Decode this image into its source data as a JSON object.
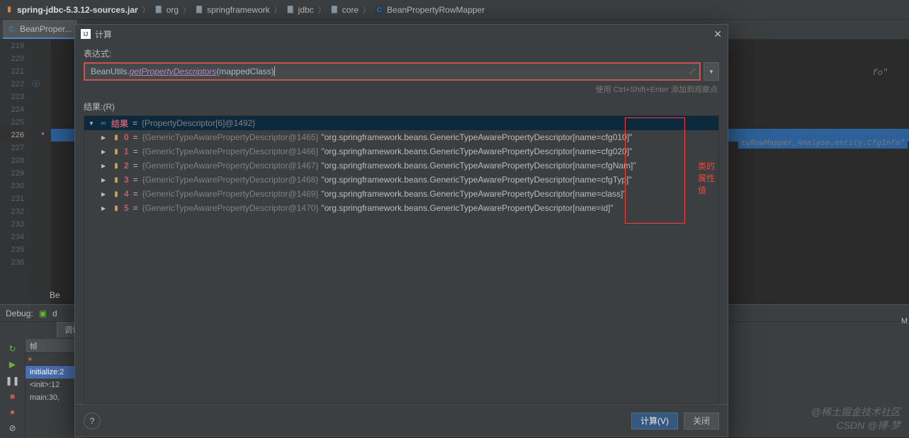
{
  "breadcrumb": [
    {
      "icon": "jar",
      "label": "spring-jdbc-5.3.12-sources.jar",
      "bold": true
    },
    {
      "icon": "folder",
      "label": "org"
    },
    {
      "icon": "folder",
      "label": "springframework"
    },
    {
      "icon": "folder",
      "label": "jdbc"
    },
    {
      "icon": "folder",
      "label": "core"
    },
    {
      "icon": "class",
      "label": "BeanPropertyRowMapper"
    }
  ],
  "tab": {
    "label": "BeanProper..."
  },
  "gutter": {
    "start": 219,
    "end": 236,
    "highlight": 226
  },
  "editor": {
    "right_hint_220": "fo\"",
    "right_hint_226": "tyRowMapper_Analyse.entity.CfgInfo\"",
    "trailing_label": "Be"
  },
  "dialog": {
    "title": "计算",
    "expr_label": "表达式:",
    "expr": {
      "cls": "BeanUtils.",
      "method": "getPropertyDescriptors",
      "open": "(",
      "param": "mappedClass",
      "close": ")"
    },
    "hint": "使用 Ctrl+Shift+Enter 添加到观察点",
    "result_label": "结果:(R)",
    "root": {
      "key": "结果",
      "type": "{PropertyDescriptor[6]@1492}"
    },
    "items": [
      {
        "idx": "0",
        "type": "{GenericTypeAwarePropertyDescriptor@1465}",
        "val": "\"org.springframework.beans.GenericTypeAwarePropertyDescriptor[name=cfg010]\""
      },
      {
        "idx": "1",
        "type": "{GenericTypeAwarePropertyDescriptor@1466}",
        "val": "\"org.springframework.beans.GenericTypeAwarePropertyDescriptor[name=cfg020]\""
      },
      {
        "idx": "2",
        "type": "{GenericTypeAwarePropertyDescriptor@1467}",
        "val": "\"org.springframework.beans.GenericTypeAwarePropertyDescriptor[name=cfgNam]\""
      },
      {
        "idx": "3",
        "type": "{GenericTypeAwarePropertyDescriptor@1468}",
        "val": "\"org.springframework.beans.GenericTypeAwarePropertyDescriptor[name=cfgTyp]\""
      },
      {
        "idx": "4",
        "type": "{GenericTypeAwarePropertyDescriptor@1469}",
        "val": "\"org.springframework.beans.GenericTypeAwarePropertyDescriptor[name=class]\""
      },
      {
        "idx": "5",
        "type": "{GenericTypeAwarePropertyDescriptor@1470}",
        "val": "\"org.springframework.beans.GenericTypeAwarePropertyDescriptor[name=id]\""
      }
    ],
    "annotation": "类的属性值",
    "evaluate_btn": "计算(V)",
    "close_btn": "关闭"
  },
  "debug": {
    "label": "Debug:",
    "tab_icon": "d",
    "debugger_tab": "调试器",
    "frames_label": "帧",
    "frames_toggle": "↕",
    "frames": [
      {
        "label": "initialize:2",
        "selected": true
      },
      {
        "label": "<init>:12"
      },
      {
        "label": "main:30,"
      }
    ],
    "right_label": "M"
  },
  "watermark": {
    "line1": "@稀土掘金技术社区",
    "line2": "CSDN @搏·梦"
  }
}
